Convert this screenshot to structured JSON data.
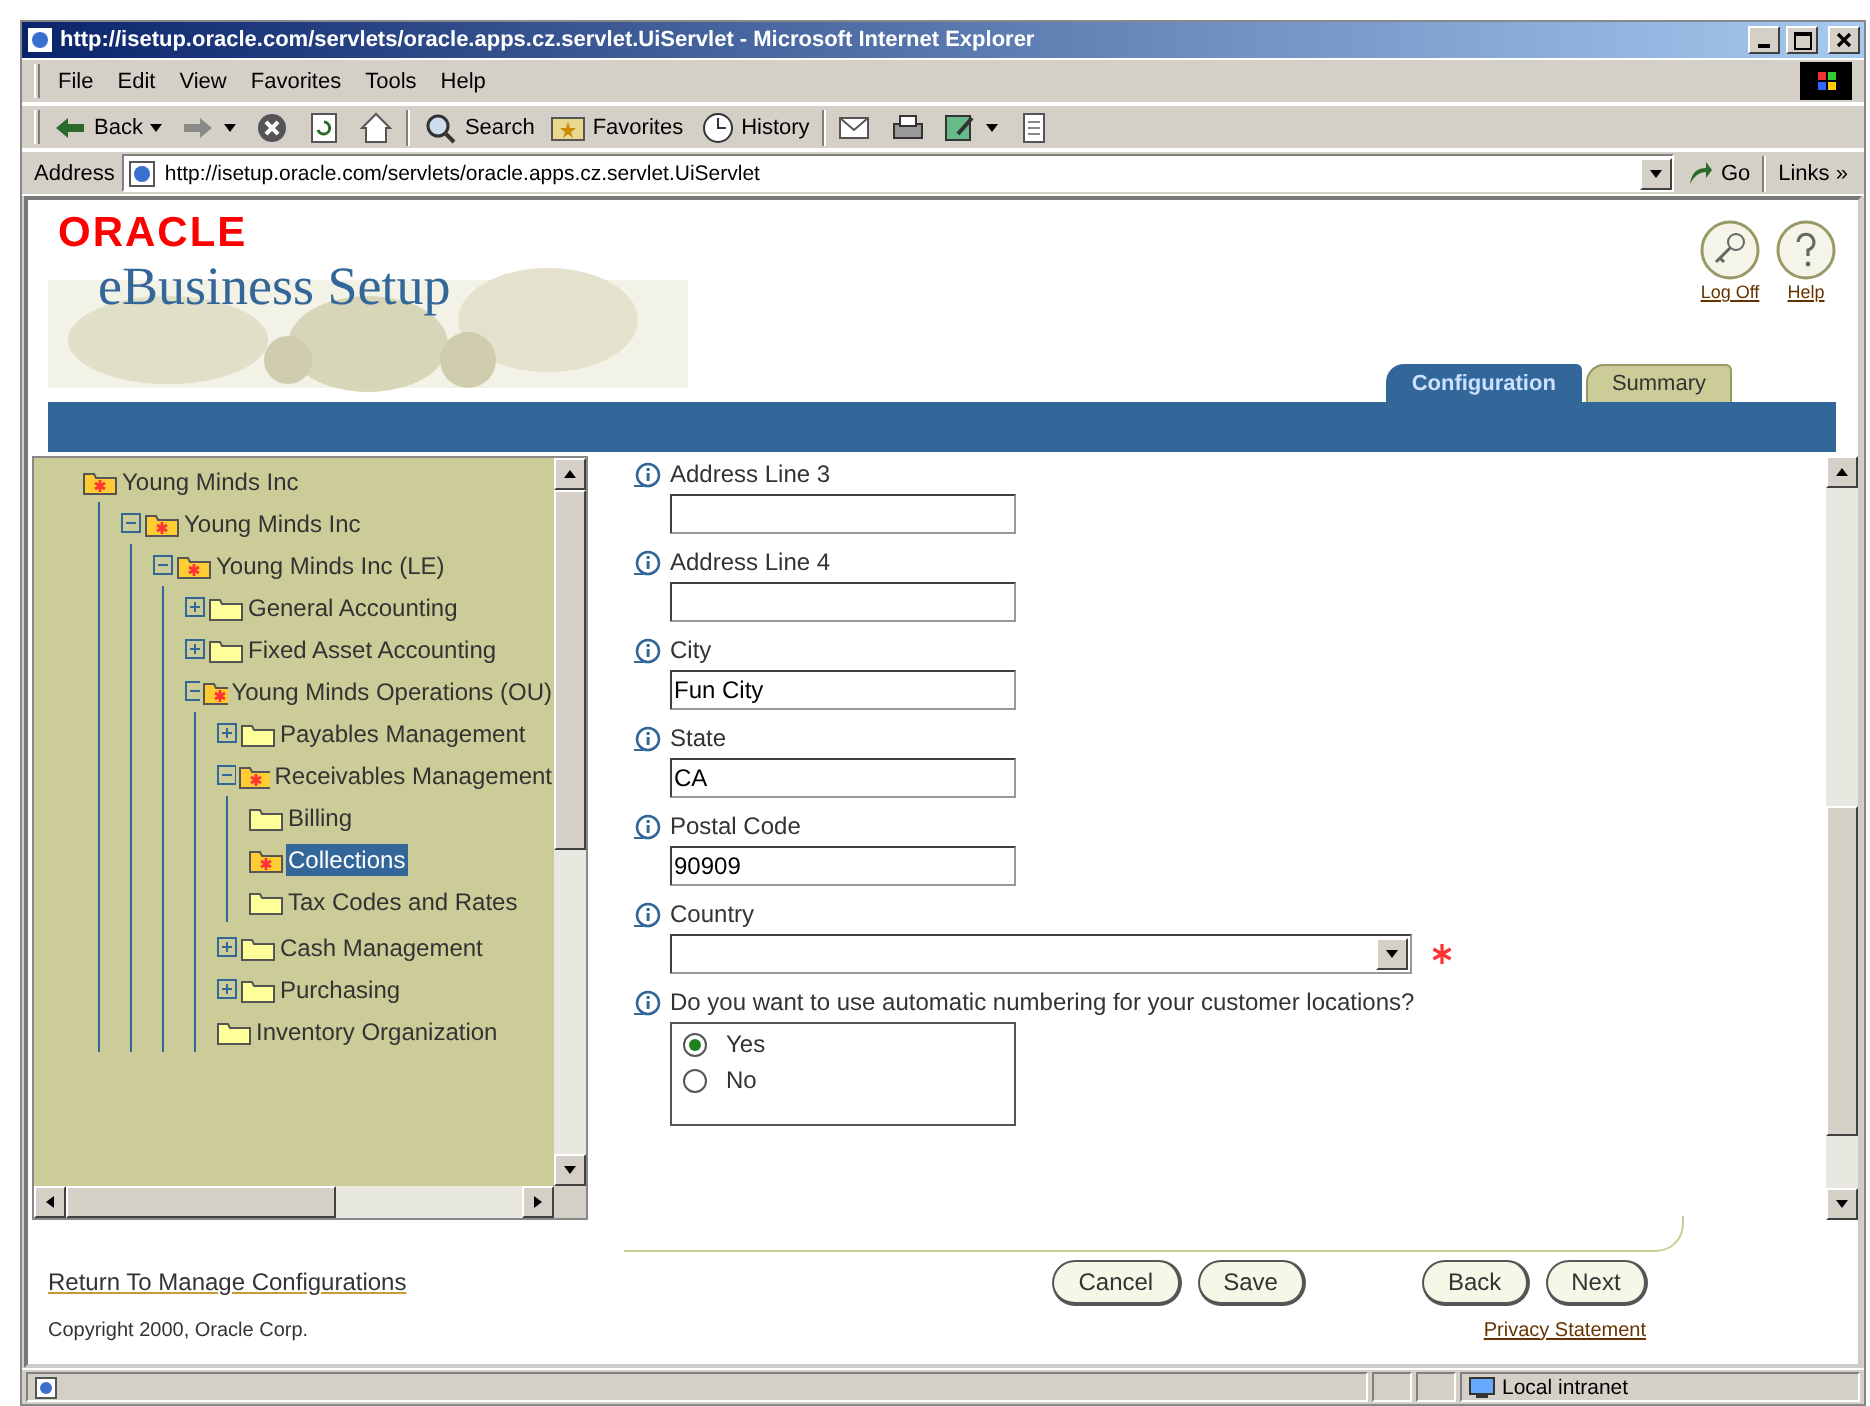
{
  "window": {
    "title": "http://isetup.oracle.com/servlets/oracle.apps.cz.servlet.UiServlet - Microsoft Internet Explorer"
  },
  "menu": [
    "File",
    "Edit",
    "View",
    "Favorites",
    "Tools",
    "Help"
  ],
  "toolbar_groups": [
    [
      {
        "kind": "back",
        "label": "Back"
      },
      {
        "kind": "forward"
      },
      {
        "kind": "stop"
      },
      {
        "kind": "refresh"
      },
      {
        "kind": "home"
      }
    ],
    [
      {
        "kind": "search",
        "label": "Search"
      },
      {
        "kind": "favorites",
        "label": "Favorites"
      },
      {
        "kind": "history",
        "label": "History"
      }
    ],
    [
      {
        "kind": "mail"
      },
      {
        "kind": "print"
      },
      {
        "kind": "edit"
      },
      {
        "kind": "discuss"
      }
    ]
  ],
  "address": {
    "label": "Address",
    "url": "http://isetup.oracle.com/servlets/oracle.apps.cz.servlet.UiServlet",
    "go": "Go",
    "links": "Links",
    "more": "»"
  },
  "header": {
    "logo": "ORACLE",
    "product": "eBusiness Setup",
    "links": [
      {
        "kind": "logoff",
        "label": "Log Off"
      },
      {
        "kind": "help",
        "label": "Help"
      }
    ]
  },
  "tabs": [
    {
      "label": "Configuration",
      "selected": true
    },
    {
      "label": "Summary",
      "selected": false
    }
  ],
  "tree": [
    {
      "label": "Young Minds Inc",
      "marked": true,
      "selected": false,
      "children": [
        {
          "label": "Young Minds Inc",
          "marked": true,
          "expanded": true,
          "selected": false,
          "children": [
            {
              "label": "Young Minds Inc (LE)",
              "marked": true,
              "expanded": true,
              "selected": false,
              "children": [
                {
                  "label": "General Accounting",
                  "marked": false,
                  "expanded": false,
                  "selected": false
                },
                {
                  "label": "Fixed Asset Accounting",
                  "marked": false,
                  "expanded": false,
                  "selected": false
                },
                {
                  "label": "Young Minds Operations (OU)",
                  "marked": true,
                  "expanded": true,
                  "selected": false,
                  "children": [
                    {
                      "label": "Payables Management",
                      "marked": false,
                      "expanded": false,
                      "selected": false
                    },
                    {
                      "label": "Receivables Management",
                      "marked": true,
                      "expanded": true,
                      "selected": false,
                      "children": [
                        {
                          "label": "Billing",
                          "marked": false,
                          "selected": false
                        },
                        {
                          "label": "Collections",
                          "marked": true,
                          "selected": true
                        },
                        {
                          "label": "Tax Codes and Rates",
                          "marked": false,
                          "selected": false
                        }
                      ]
                    },
                    {
                      "label": "Cash Management",
                      "marked": false,
                      "expanded": false,
                      "selected": false
                    },
                    {
                      "label": "Purchasing",
                      "marked": false,
                      "expanded": false,
                      "selected": false
                    },
                    {
                      "label": "Inventory Organization",
                      "marked": false,
                      "selected": false
                    }
                  ]
                }
              ]
            }
          ]
        }
      ]
    }
  ],
  "form": {
    "fields": [
      {
        "kind": "text",
        "label": "Address Line 3"
      },
      {
        "kind": "text",
        "label": "Address Line 4"
      },
      {
        "kind": "text",
        "label": "City",
        "value": "Fun City"
      },
      {
        "kind": "text",
        "label": "State",
        "value": "CA"
      },
      {
        "kind": "text",
        "label": "Postal Code",
        "value": "90909"
      },
      {
        "kind": "select",
        "label": "Country",
        "required": true
      },
      {
        "kind": "radio",
        "label": "Do you want to use automatic numbering for your customer locations?",
        "options": [
          {
            "label": "Yes",
            "selected": true
          },
          {
            "label": "No",
            "selected": false
          }
        ]
      }
    ]
  },
  "footer": {
    "return_link": "Return To Manage Configurations",
    "buttons": [
      "Cancel",
      "Save"
    ],
    "nav_buttons": [
      "Back",
      "Next"
    ],
    "copyright": "Copyright 2000, Oracle Corp.",
    "privacy_link": "Privacy Statement"
  },
  "status_bar": {
    "zone": "Local intranet"
  }
}
